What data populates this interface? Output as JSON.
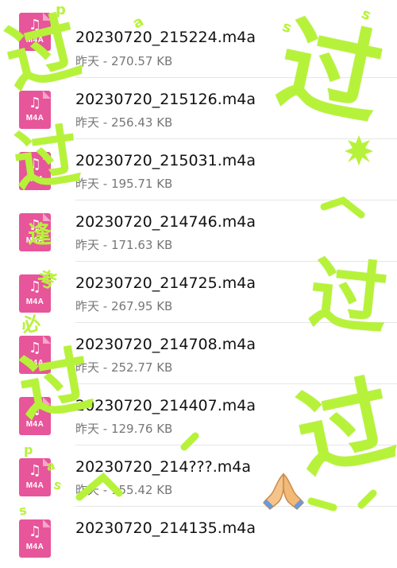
{
  "files": [
    {
      "name": "20230720_215224.m4a",
      "meta": "昨天 - 270.57 KB",
      "icon_label": "M4A"
    },
    {
      "name": "20230720_215126.m4a",
      "meta": "昨天 - 256.43 KB",
      "icon_label": "M4A"
    },
    {
      "name": "20230720_215031.m4a",
      "meta": "昨天 - 195.71 KB",
      "icon_label": "M4A"
    },
    {
      "name": "20230720_214746.m4a",
      "meta": "昨天 - 171.63 KB",
      "icon_label": "M4A"
    },
    {
      "name": "20230720_214725.m4a",
      "meta": "昨天 - 267.95 KB",
      "icon_label": "M4A"
    },
    {
      "name": "20230720_214708.m4a",
      "meta": "昨天 - 252.77 KB",
      "icon_label": "M4A"
    },
    {
      "name": "20230720_214407.m4a",
      "meta": "昨天 - 129.76 KB",
      "icon_label": "M4A"
    },
    {
      "name": "20230720_214???.m4a",
      "meta": "昨天 - 155.42 KB",
      "icon_label": "M4A"
    },
    {
      "name": "20230720_214135.m4a",
      "meta": "",
      "icon_label": "M4A"
    }
  ],
  "icon_glyph": "♫",
  "stickers": {
    "big_chars": [
      "过",
      "过",
      "过",
      "过",
      "过",
      "过"
    ],
    "small_chars": [
      "逢",
      "考",
      "必"
    ],
    "letters": [
      "p",
      "a",
      "s",
      "s",
      "p",
      "a",
      "s",
      "s"
    ]
  },
  "colors": {
    "sticker": "#b7f23a",
    "file_icon": "#e7559a",
    "divider": "#e6e6e6"
  }
}
